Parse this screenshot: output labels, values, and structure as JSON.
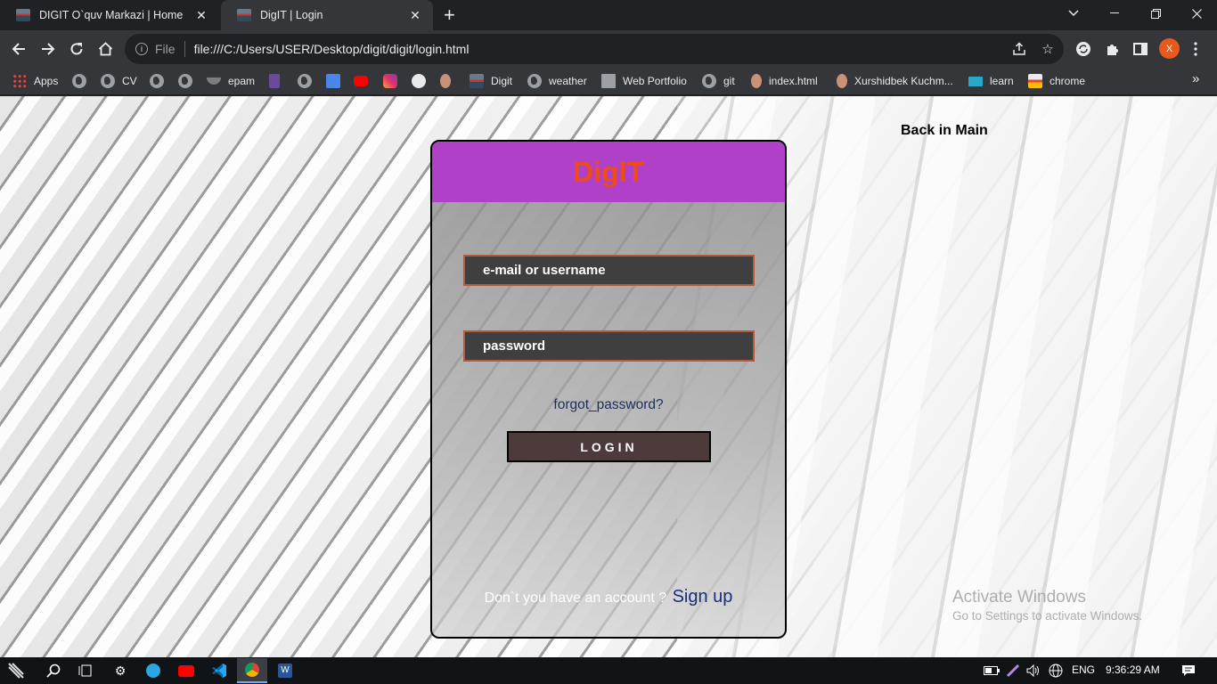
{
  "browser": {
    "tabs": [
      {
        "title": "DIGIT O`quv Markazi | Home",
        "close": "✕"
      },
      {
        "title": "DigIT | Login",
        "close": "✕"
      }
    ],
    "new_tab": "+",
    "omnibox": {
      "scheme_label": "File",
      "url": "file:///C:/Users/USER/Desktop/digit/digit/login.html"
    },
    "profile_initial": "X",
    "bookmarks": [
      {
        "label": "Apps",
        "icon": "apps-grid-icon"
      },
      {
        "label": "",
        "icon": "globe-icon"
      },
      {
        "label": "CV",
        "icon": "globe-icon"
      },
      {
        "label": "",
        "icon": "globe-icon"
      },
      {
        "label": "",
        "icon": "globe-icon"
      },
      {
        "label": "epam",
        "icon": "epam-icon"
      },
      {
        "label": "",
        "icon": "bookmark-icon"
      },
      {
        "label": "",
        "icon": "globe-icon"
      },
      {
        "label": "",
        "icon": "google-translate-icon"
      },
      {
        "label": "",
        "icon": "youtube-icon"
      },
      {
        "label": "",
        "icon": "instagram-icon"
      },
      {
        "label": "",
        "icon": "github-icon"
      },
      {
        "label": "",
        "icon": "avatar-icon"
      },
      {
        "label": "Digit",
        "icon": "digit-icon"
      },
      {
        "label": "weather",
        "icon": "globe-icon"
      },
      {
        "label": "Web Portfolio",
        "icon": "portfolio-icon"
      },
      {
        "label": "git",
        "icon": "globe-icon"
      },
      {
        "label": "index.html",
        "icon": "avatar-icon"
      },
      {
        "label": "Xurshidbek Kuchm...",
        "icon": "avatar-icon"
      },
      {
        "label": "learn",
        "icon": "learn-icon"
      },
      {
        "label": "chrome",
        "icon": "chrome-icon"
      }
    ],
    "bookmarks_more": "»"
  },
  "page": {
    "back_link": "Back in Main",
    "brand": "DigIT",
    "email_placeholder": "e-mail or username",
    "password_placeholder": "password",
    "forgot": "forgot_password?",
    "login_button": "LOGIN",
    "signup_prompt": "Don`t you have an account ?",
    "signup_link": "Sign up",
    "watermark_title": "Activate Windows",
    "watermark_sub": "Go to Settings to activate Windows."
  },
  "taskbar": {
    "language": "ENG",
    "time": "9:36:29 AM"
  },
  "colors": {
    "brand_text": "#ef4b14",
    "card_header": "#b040c8",
    "field_border": "#b45a3c",
    "login_bg": "#4d3a3a"
  }
}
